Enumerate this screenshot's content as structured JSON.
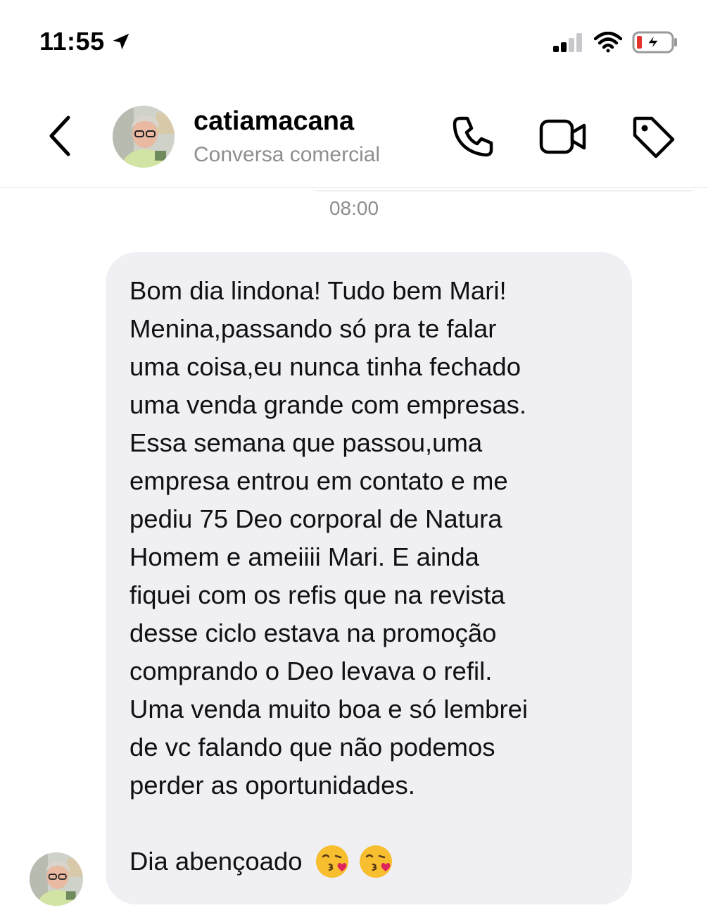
{
  "status_bar": {
    "time": "11:55",
    "icons": [
      "location-arrow-icon",
      "cellular-signal-icon",
      "wifi-icon",
      "battery-charging-icon"
    ]
  },
  "header": {
    "contact_name": "catiamacana",
    "subtitle": "Conversa comercial",
    "icons": [
      "chevron-left-icon",
      "phone-icon",
      "video-camera-icon",
      "tag-icon"
    ]
  },
  "chat": {
    "timestamp": "08:00",
    "message": {
      "body": "Bom dia lindona! Tudo bem Mari!\nMenina,passando só pra te falar\numa coisa,eu nunca tinha fechado\numa venda grande com empresas.\nEssa semana que passou,uma\nempresa entrou em contato e me\npediu 75 Deo corporal de Natura\nHomem e ameiiii Mari. E ainda\nfiquei com os refis que na revista\ndesse ciclo estava na promoção\ncomprando o Deo levava o refil.\nUma venda muito boa e só lembrei\nde vc falando que não podemos\nperder as oportunidades.",
      "closing": "Dia abençoado",
      "emojis": [
        "kissing-face-emoji",
        "kissing-face-emoji"
      ]
    }
  },
  "colors": {
    "bubble_bg": "#efeff4",
    "secondary_text": "#8e8e8e",
    "battery_low": "#e5322d"
  }
}
